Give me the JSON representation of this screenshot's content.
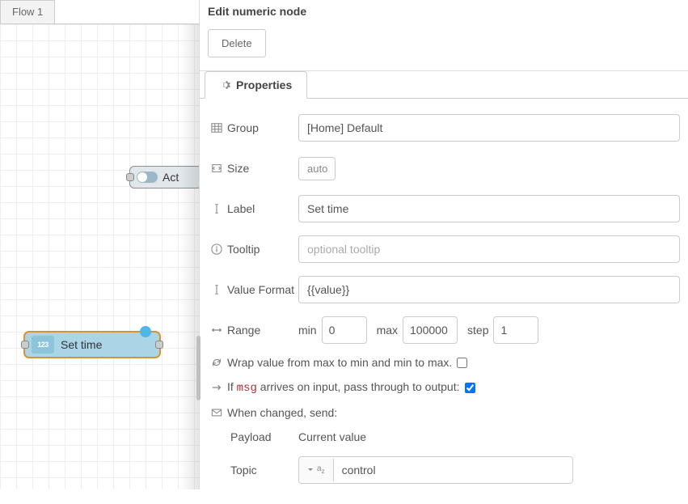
{
  "tab_name": "Flow 1",
  "nodes": {
    "act_label": "Act",
    "settime_label": "Set time",
    "settime_icon": "123"
  },
  "panel": {
    "title": "Edit numeric node",
    "delete": "Delete",
    "properties_tab": "Properties",
    "group": {
      "label": "Group",
      "value": "[Home] Default"
    },
    "size": {
      "label": "Size",
      "value": "auto"
    },
    "labelfield": {
      "label": "Label",
      "value": "Set time"
    },
    "tooltip": {
      "label": "Tooltip",
      "placeholder": "optional tooltip"
    },
    "valuefmt": {
      "label": "Value Format",
      "value": "{{value}}"
    },
    "range": {
      "label": "Range",
      "min_label": "min",
      "min": "0",
      "max_label": "max",
      "max": "100000",
      "step_label": "step",
      "step": "1"
    },
    "wrap": {
      "text": "Wrap value from max to min and min to max.",
      "checked": false
    },
    "passthrough": {
      "prefix": "If ",
      "msg": "msg",
      "suffix": " arrives on input, pass through to output:",
      "checked": true
    },
    "whenchanged": "When changed, send:",
    "payload": {
      "label": "Payload",
      "value": "Current value"
    },
    "topic": {
      "label": "Topic",
      "value": "control"
    }
  }
}
